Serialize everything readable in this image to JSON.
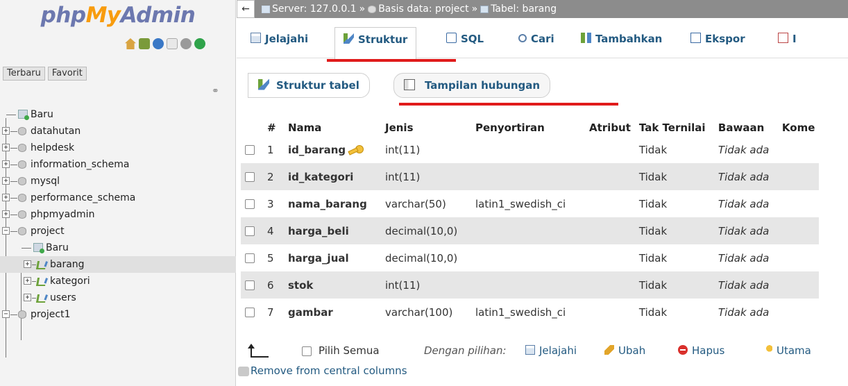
{
  "sidebar": {
    "logo": {
      "part1": "php",
      "part2": "My",
      "part3": "Admin"
    },
    "quick_icons": [
      "home-icon",
      "exit-icon",
      "help-icon",
      "docs-icon",
      "settings-icon",
      "reload-icon"
    ],
    "buttons": {
      "recent": "Terbaru",
      "favorites": "Favorit"
    },
    "tree": {
      "new": "Baru",
      "databases": [
        "datahutan",
        "helpdesk",
        "information_schema",
        "mysql",
        "performance_schema",
        "phpmyadmin",
        "project"
      ],
      "project_children": {
        "new": "Baru",
        "tables": [
          "barang",
          "kategori",
          "users"
        ]
      },
      "last_db": "project1"
    }
  },
  "breadcrumb": {
    "back": "←",
    "server": "Server: 127.0.0.1",
    "database": "Basis data: project",
    "table": "Tabel: barang",
    "separator": "»"
  },
  "tabs": [
    "Jelajahi",
    "Struktur",
    "SQL",
    "Cari",
    "Tambahkan",
    "Ekspor",
    "I"
  ],
  "subnav": {
    "table_structure": "Struktur tabel",
    "relation_view": "Tampilan hubungan"
  },
  "table": {
    "headers": [
      "#",
      "Nama",
      "Jenis",
      "Penyortiran",
      "Atribut",
      "Tak Ternilai",
      "Bawaan",
      "Kome"
    ],
    "rows": [
      {
        "num": "1",
        "name": "id_barang",
        "type": "int(11)",
        "collation": "",
        "attributes": "",
        "null": "Tidak",
        "default": "Tidak ada",
        "primary": true
      },
      {
        "num": "2",
        "name": "id_kategori",
        "type": "int(11)",
        "collation": "",
        "attributes": "",
        "null": "Tidak",
        "default": "Tidak ada",
        "primary": false
      },
      {
        "num": "3",
        "name": "nama_barang",
        "type": "varchar(50)",
        "collation": "latin1_swedish_ci",
        "attributes": "",
        "null": "Tidak",
        "default": "Tidak ada",
        "primary": false
      },
      {
        "num": "4",
        "name": "harga_beli",
        "type": "decimal(10,0)",
        "collation": "",
        "attributes": "",
        "null": "Tidak",
        "default": "Tidak ada",
        "primary": false
      },
      {
        "num": "5",
        "name": "harga_jual",
        "type": "decimal(10,0)",
        "collation": "",
        "attributes": "",
        "null": "Tidak",
        "default": "Tidak ada",
        "primary": false
      },
      {
        "num": "6",
        "name": "stok",
        "type": "int(11)",
        "collation": "",
        "attributes": "",
        "null": "Tidak",
        "default": "Tidak ada",
        "primary": false
      },
      {
        "num": "7",
        "name": "gambar",
        "type": "varchar(100)",
        "collation": "latin1_swedish_ci",
        "attributes": "",
        "null": "Tidak",
        "default": "Tidak ada",
        "primary": false
      }
    ]
  },
  "bulk": {
    "select_all": "Pilih Semua",
    "with_selected": "Dengan pilihan:",
    "browse": "Jelajahi",
    "change": "Ubah",
    "drop": "Hapus",
    "primary": "Utama"
  },
  "remove_central": "Remove from central columns",
  "colors": {
    "link": "#235a81",
    "annotation_red": "#e01b1b",
    "breadcrumb_bg": "#8c8c8c"
  }
}
